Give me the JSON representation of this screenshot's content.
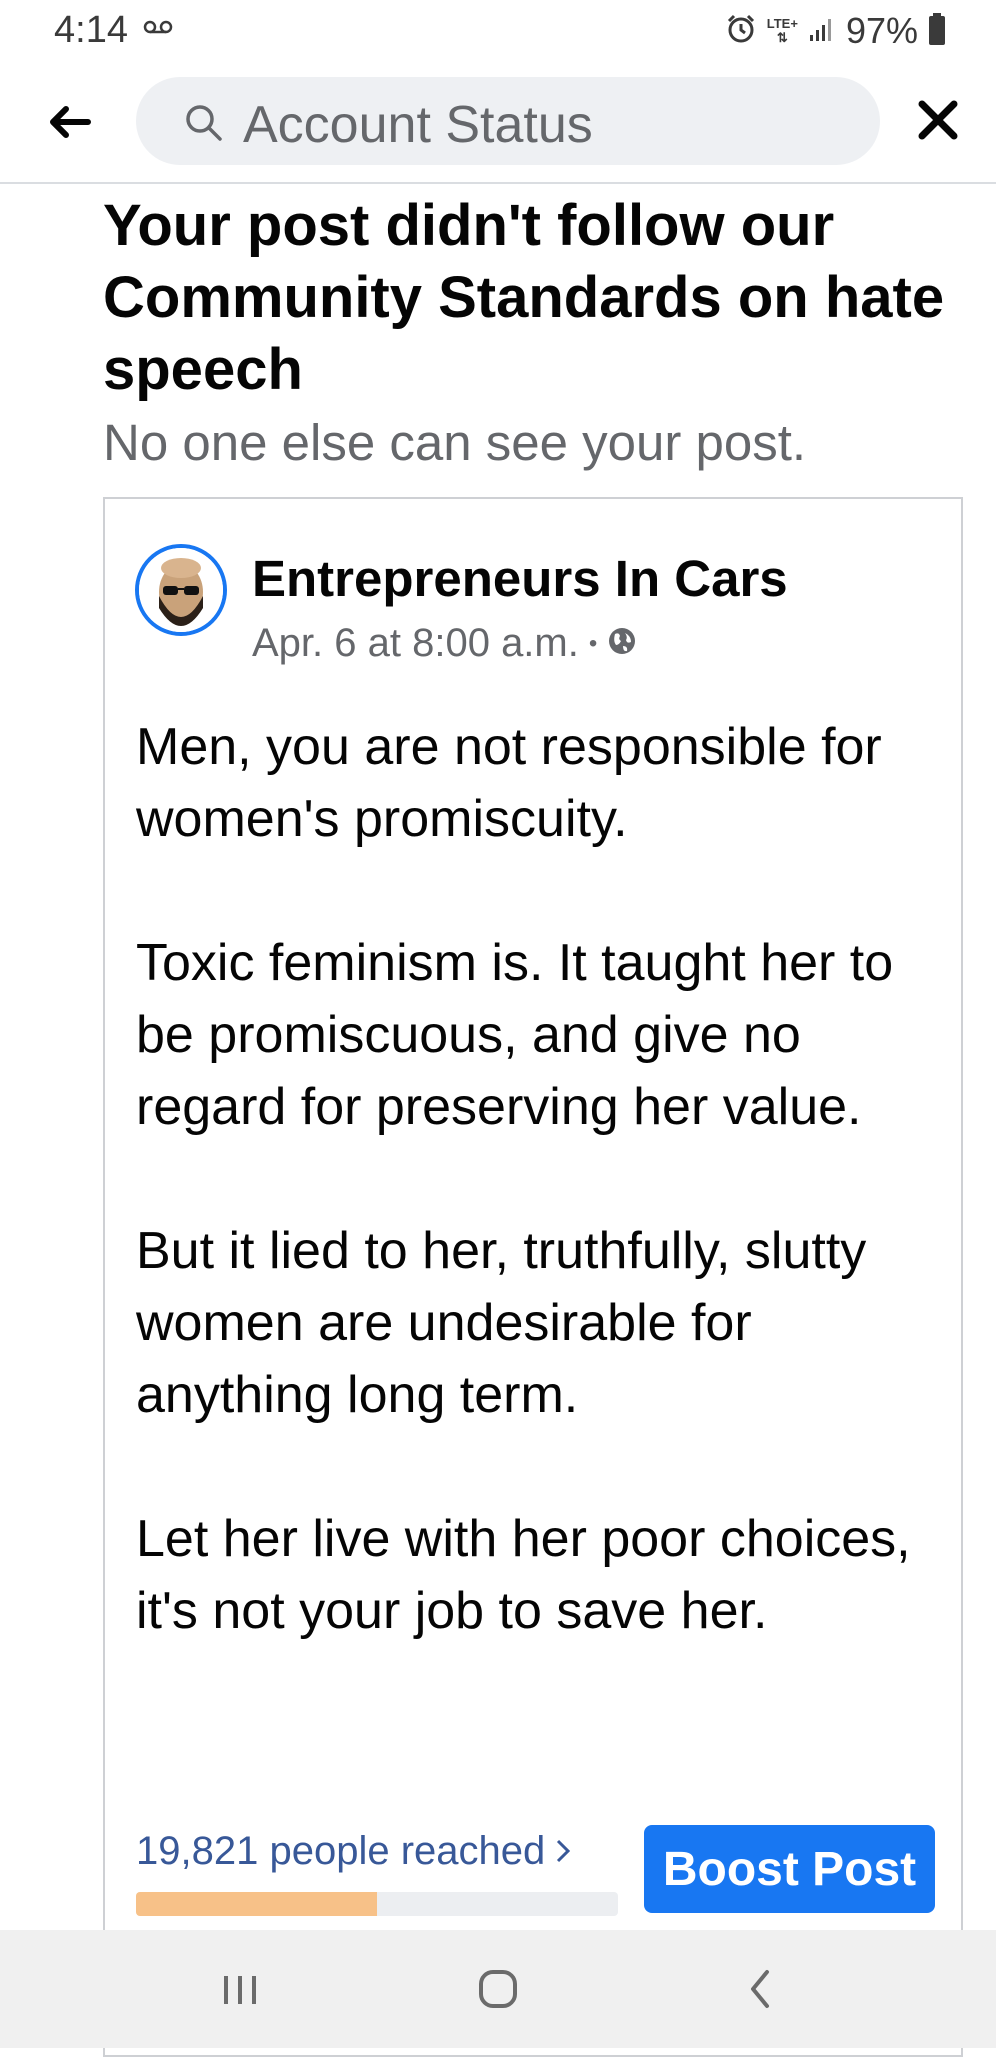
{
  "status_bar": {
    "time": "4:14",
    "network": "LTE+",
    "battery": "97%",
    "icons": [
      "voicemail-icon",
      "alarm-icon",
      "signal-icon",
      "battery-icon"
    ]
  },
  "header": {
    "search_text": "Account Status",
    "back_icon": "arrow-left-icon",
    "close_icon": "close-icon"
  },
  "notice": {
    "title": "Your post didn't follow our Community Standards on hate speech",
    "subtitle": "No one else can see your post."
  },
  "post": {
    "author": "Entrepreneurs In Cars",
    "timestamp": "Apr. 6 at 8:00 a.m.",
    "separator": "•",
    "privacy_icon": "globe-icon",
    "paragraphs": [
      "Men, you are not responsible for women's promiscuity.",
      "Toxic feminism is.  It taught her to be promiscuous, and give no regard for preserving her value.",
      "But it lied to her, truthfully, slutty women are undesirable for anything long term.",
      "Let her live with her poor choices, it's not your job to save her."
    ],
    "reach_text": "19,821 people reached",
    "reach_progress": 0.5,
    "boost_label": "Boost Post"
  },
  "colors": {
    "accent": "#1877f2",
    "reach_link": "#385898",
    "reach_fill": "#f7c188",
    "secondary_text": "#65676b"
  },
  "nav_bar": {
    "icons": [
      "recents-icon",
      "home-icon",
      "back-icon"
    ]
  }
}
